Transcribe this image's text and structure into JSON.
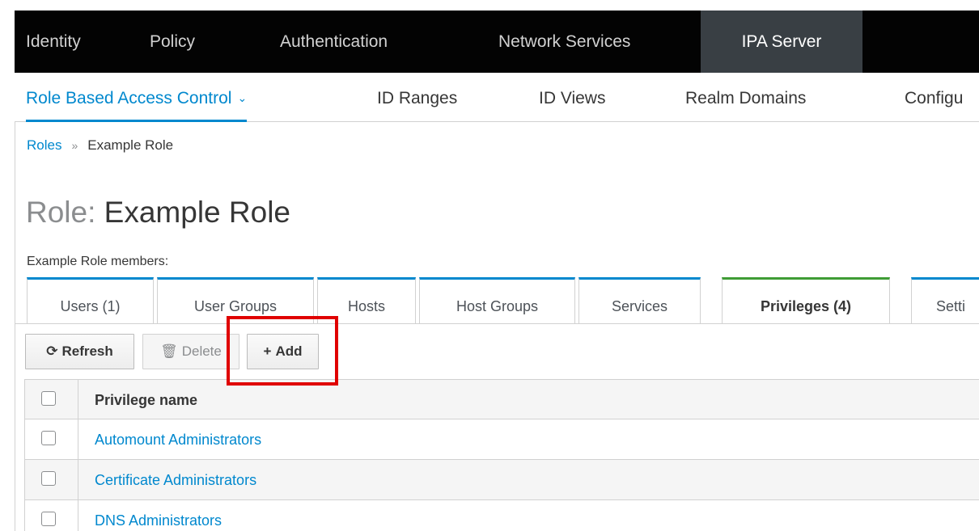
{
  "top_nav": {
    "items": [
      {
        "label": "Identity"
      },
      {
        "label": "Policy"
      },
      {
        "label": "Authentication"
      },
      {
        "label": "Network Services"
      },
      {
        "label": "IPA Server",
        "active": true
      }
    ]
  },
  "sub_nav": {
    "items": [
      {
        "label": "Role Based Access Control",
        "active": true,
        "dropdown_icon": "chevron-down-icon"
      },
      {
        "label": "ID Ranges"
      },
      {
        "label": "ID Views"
      },
      {
        "label": "Realm Domains"
      },
      {
        "label": "Configu"
      }
    ]
  },
  "breadcrumb": {
    "parent": "Roles",
    "separator": "»",
    "current": "Example Role"
  },
  "page": {
    "title_prefix": "Role:",
    "title": "Example Role",
    "members_label": "Example Role members:"
  },
  "tabs": [
    {
      "label": "Users (1)"
    },
    {
      "label": "User Groups"
    },
    {
      "label": "Hosts"
    },
    {
      "label": "Host Groups"
    },
    {
      "label": "Services"
    },
    {
      "label": "Privileges (4)",
      "active": true
    },
    {
      "label": "Setti"
    }
  ],
  "toolbar": {
    "refresh": {
      "label": "Refresh",
      "icon": "refresh-icon"
    },
    "delete": {
      "label": "Delete",
      "icon": "trash-icon",
      "disabled": true
    },
    "add": {
      "label": "Add",
      "icon": "plus-icon"
    }
  },
  "table": {
    "column_header": "Privilege name",
    "rows": [
      {
        "name": "Automount Administrators"
      },
      {
        "name": "Certificate Administrators"
      },
      {
        "name": "DNS Administrators"
      }
    ]
  },
  "colors": {
    "accent": "#0088ce",
    "active_tab": "#3f9c35",
    "highlight": "#e00000",
    "top_nav_bg": "#030303"
  }
}
